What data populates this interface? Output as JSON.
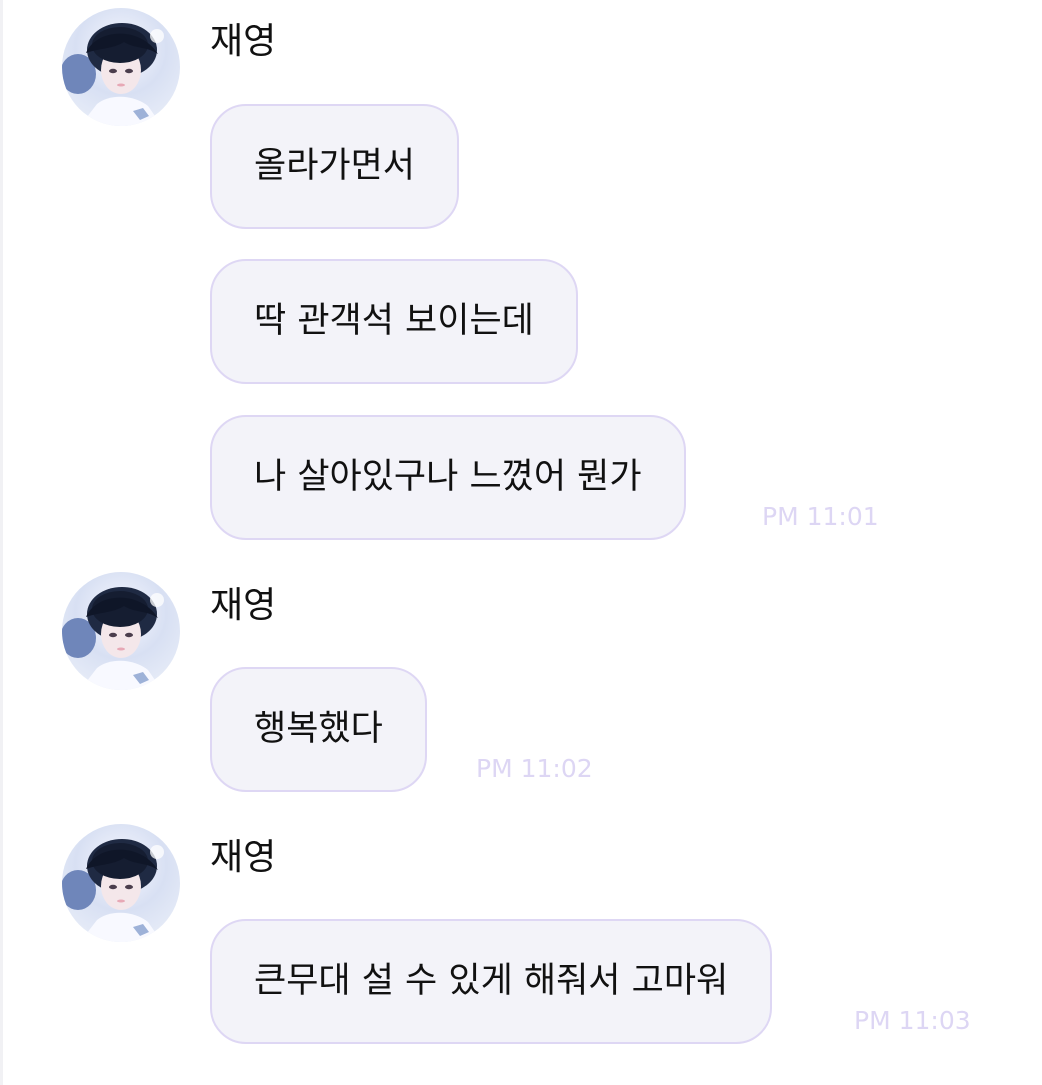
{
  "chat": {
    "groups": [
      {
        "sender": "재영",
        "avatar_icon": "profile-photo-icon",
        "messages": [
          {
            "text": "올라가면서",
            "time": ""
          },
          {
            "text": "딱 관객석 보이는데",
            "time": ""
          },
          {
            "text": "나 살아있구나 느꼈어 뭔가",
            "time": "PM 11:01"
          }
        ]
      },
      {
        "sender": "재영",
        "avatar_icon": "profile-photo-icon",
        "messages": [
          {
            "text": "행복했다",
            "time": "PM 11:02"
          }
        ]
      },
      {
        "sender": "재영",
        "avatar_icon": "profile-photo-icon",
        "messages": [
          {
            "text": "큰무대 설 수 있게 해줘서 고마워",
            "time": "PM 11:03"
          }
        ]
      }
    ]
  },
  "colors": {
    "bubble_background": "#f3f3f9",
    "bubble_border": "#ded7f4",
    "timestamp": "#ddd6f4",
    "text": "#111111"
  }
}
